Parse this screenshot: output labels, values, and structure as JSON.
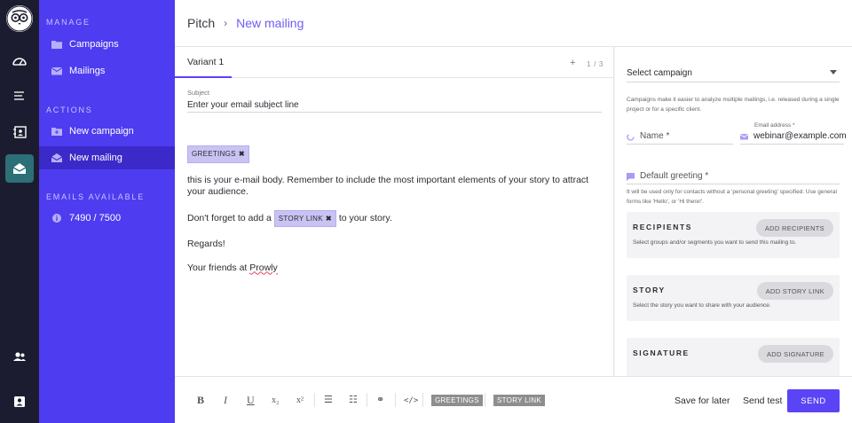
{
  "breadcrumb": {
    "root": "Pitch",
    "separator": "›",
    "current": "New mailing"
  },
  "nav": {
    "manage_title": "MANAGE",
    "manage_items": [
      {
        "label": "Campaigns",
        "icon": "folder-icon"
      },
      {
        "label": "Mailings",
        "icon": "mail-icon"
      }
    ],
    "actions_title": "ACTIONS",
    "action_items": [
      {
        "label": "New campaign",
        "icon": "folder-add-icon"
      },
      {
        "label": "New mailing",
        "icon": "mail-open-icon",
        "active": true
      }
    ],
    "emails_title": "EMAILS AVAILABLE",
    "emails_value": "7490 / 7500"
  },
  "rail": {
    "icons": [
      "logo-owl-icon",
      "dashboard-gauge-icon",
      "menu-list-icon",
      "contacts-book-icon",
      "mailing-envelope-icon",
      "team-icon",
      "account-icon"
    ]
  },
  "editor": {
    "tab_label": "Variant 1",
    "tab_add": "+",
    "tab_count": "1 / 3",
    "subject_label": "Subject",
    "subject_placeholder": "Enter your email subject line",
    "greetings_chip": "GREETINGS",
    "chip_close": "✖",
    "body_line1": "this is your e-mail body. Remember to include the most important elements of your story to attract your audience.",
    "body_line2_pre": "Don't forget to add a",
    "story_link_chip": "STORY LINK",
    "body_line2_post": "to your story.",
    "body_line3": "Regards!",
    "body_line4_pre": "Your friends at",
    "body_line4_brand": "Prowly"
  },
  "toolbar": {
    "bold": "B",
    "italic": "I",
    "underline": "U",
    "subscript": "x₂",
    "superscript": "x²",
    "ordered_list": "☰",
    "bullet_list": "☷",
    "link": "⚭",
    "code": "</>",
    "greetings_tag": "GREETINGS",
    "story_link_tag": "STORY LINK",
    "save_label": "Save for later",
    "test_label": "Send test",
    "send_label": "SEND"
  },
  "side": {
    "campaign_select": "Select campaign",
    "campaign_hint": "Campaigns make it easier to analyze multiple mailings, i.e. released during a single project or for a specific client.",
    "name_placeholder": "Name *",
    "email_label": "Email address *",
    "email_value": "webinar@example.com",
    "greeting_placeholder": "Default greeting *",
    "greeting_hint": "It will be used only for contacts without a 'personal greeting' specified. Use general forms like 'Hello', or 'Hi there!'.",
    "recipients": {
      "title": "RECIPIENTS",
      "button": "ADD RECIPIENTS",
      "desc": "Select groups and/or segments you want to send this mailing to."
    },
    "story": {
      "title": "STORY",
      "button": "ADD STORY LINK",
      "desc": "Select the story you want to share with your audience."
    },
    "signature": {
      "title": "SIGNATURE",
      "button": "ADD SIGNATURE"
    }
  },
  "colors": {
    "accent": "#5a44f5",
    "nav_bg": "#4e3cf0",
    "rail_bg": "#1c1c30",
    "rail_active": "#2c6f76",
    "chip_bg": "#c9c3f3"
  }
}
